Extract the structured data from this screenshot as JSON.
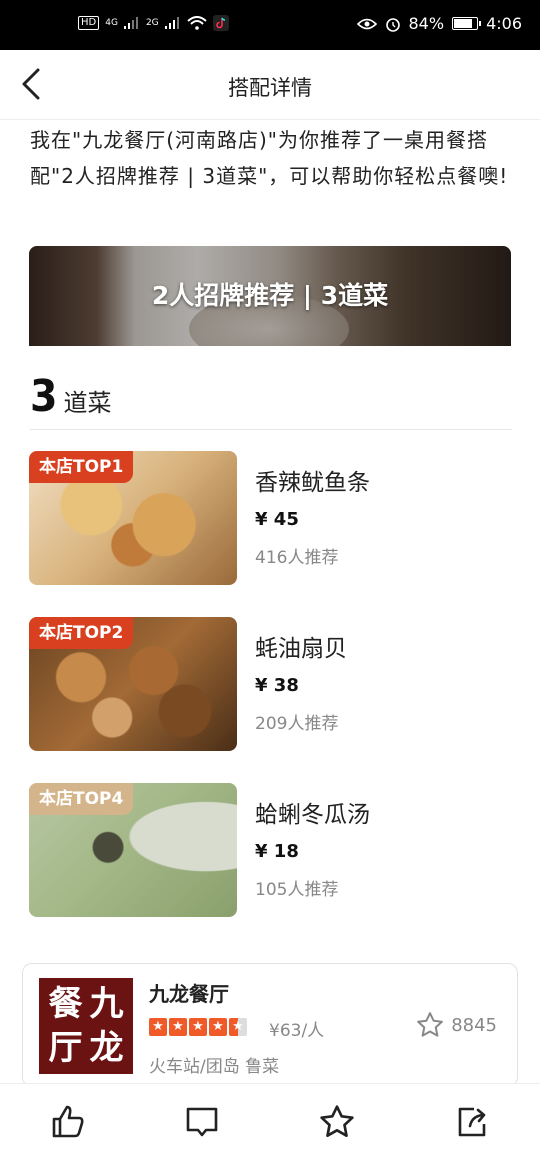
{
  "status_bar": {
    "network_badge": "HD",
    "sig1": "4G",
    "sig2": "2G",
    "battery_percent": "84%",
    "battery_level": 0.84,
    "time": "4:06"
  },
  "nav": {
    "title": "搭配详情"
  },
  "intro": {
    "text": "我在\"九龙餐厅(河南路店)\"为你推荐了一桌用餐搭配\"2人招牌推荐 | 3道菜\"，可以帮助你轻松点餐噢!"
  },
  "banner": {
    "title": "2人招牌推荐 | 3道菜"
  },
  "dishes_section": {
    "count": "3",
    "label": "道菜"
  },
  "dishes": [
    {
      "badge": "本店TOP1",
      "name": "香辣鱿鱼条",
      "price": "¥ 45",
      "recommend": "416人推荐"
    },
    {
      "badge": "本店TOP2",
      "name": "蚝油扇贝",
      "price": "¥ 38",
      "recommend": "209人推荐"
    },
    {
      "badge": "本店TOP4",
      "name": "蛤蜊冬瓜汤",
      "price": "¥ 18",
      "recommend": "105人推荐"
    }
  ],
  "restaurant": {
    "logo_chars": [
      "餐",
      "九",
      "厅",
      "龙"
    ],
    "name": "九龙餐厅",
    "rating": 4.5,
    "price": "¥63/人",
    "favorites": "8845",
    "area": "火车站/团岛  鲁菜"
  },
  "colors": {
    "accent": "#d8401f",
    "badge_tan": "#d4b48a",
    "star": "#f05a28"
  },
  "bottom_bar": {
    "icons": [
      "thumbs-up-icon",
      "comment-icon",
      "star-icon",
      "share-icon"
    ]
  }
}
